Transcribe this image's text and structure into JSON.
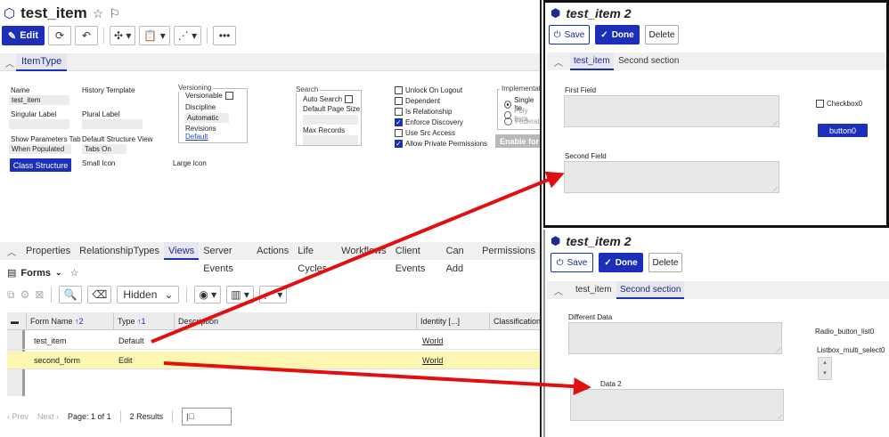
{
  "main": {
    "title": "test_item",
    "toolbar": {
      "edit_label": "Edit"
    },
    "item_tab": "ItemType",
    "fields": {
      "name_label": "Name",
      "name_value": "test_item",
      "history_label": "History Template",
      "singular_label": "Singular Label",
      "plural_label": "Plural Label",
      "show_params_label": "Show Parameters Tab",
      "show_params_value": "When Populated",
      "default_struct_label": "Default Structure View",
      "default_struct_value": "Tabs On",
      "class_structure_btn": "Class Structure",
      "small_icon_label": "Small Icon",
      "large_icon_label": "Large Icon"
    },
    "versioning": {
      "title": "Versioning",
      "versionable": "Versionable",
      "discipline": "Discipline",
      "discipline_value": "Automatic",
      "revisions": "Revisions",
      "revisions_value": "Default"
    },
    "search": {
      "title": "Search",
      "auto_search": "Auto Search",
      "default_page_size": "Default Page Size",
      "max_records": "Max Records"
    },
    "checkboxes": [
      {
        "label": "Unlock On Logout",
        "checked": false
      },
      {
        "label": "Dependent",
        "checked": false
      },
      {
        "label": "Is Relationship",
        "checked": false
      },
      {
        "label": "Enforce Discovery",
        "checked": true
      },
      {
        "label": "Use Src Access",
        "checked": false
      },
      {
        "label": "Allow Private Permissions",
        "checked": true
      }
    ],
    "implementation": {
      "title": "Implementatio",
      "options": [
        "Single Ite",
        "Poly Item",
        "Federate"
      ],
      "enable_btn": "Enable for S"
    },
    "rel_tabs": [
      "Properties",
      "RelationshipTypes",
      "Views",
      "Server Events",
      "Actions",
      "Life Cycles",
      "Workflows",
      "Client Events",
      "Can Add",
      "Permissions"
    ],
    "rel_active": "Views",
    "forms_label": "Forms",
    "hidden_select": "Hidden",
    "grid": {
      "headers": [
        {
          "label": "Form Name",
          "sort": "↑2"
        },
        {
          "label": "Type",
          "sort": "↑1"
        },
        {
          "label": "Description",
          "sort": ""
        },
        {
          "label": "Identity [...]",
          "sort": ""
        },
        {
          "label": "Classification",
          "sort": ""
        }
      ],
      "rows": [
        {
          "form_name": "test_item",
          "type": "Default",
          "identity": "World"
        },
        {
          "form_name": "second_form",
          "type": "Edit",
          "identity": "World"
        }
      ]
    },
    "pager": {
      "prev": "Prev",
      "next": "Next",
      "page": "Page: 1 of 1",
      "results": "2 Results"
    }
  },
  "pane_top": {
    "title": "test_item 2",
    "save": "Save",
    "done": "Done",
    "delete": "Delete",
    "tabs": [
      "test_item",
      "Second section"
    ],
    "active_tab": "test_item",
    "first_field": "First Field",
    "second_field": "Second Field",
    "checkbox": "Checkbox0",
    "button": "button0"
  },
  "pane_bottom": {
    "title": "test_item 2",
    "save": "Save",
    "done": "Done",
    "delete": "Delete",
    "tabs": [
      "test_item",
      "Second section"
    ],
    "active_tab": "Second section",
    "different_data": "Different Data",
    "radio_list": "Radio_button_list0",
    "listbox": "Listbox_multi_select0",
    "data2": "Data 2"
  },
  "colors": {
    "accent": "#1b2fb9",
    "arrow": "#e01010",
    "selected_row": "#fdf6b2"
  }
}
